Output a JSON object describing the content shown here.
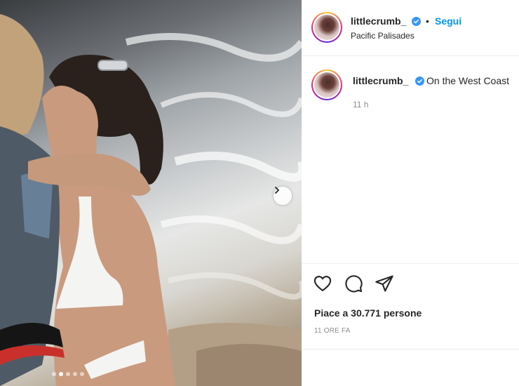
{
  "post": {
    "username": "littlecrumb_",
    "follow_label": "Segui",
    "separator": "•",
    "location": "Pacific Palisades",
    "caption": {
      "username": "littlecrumb_",
      "text": "On the West Coast",
      "time": "11 h"
    },
    "likes_text": "Piace a 30.771 persone",
    "time_ago": "11 ORE FA",
    "carousel": {
      "total_slides": 5,
      "active_slide": 2
    }
  },
  "icons": {
    "verified": "verified-badge-icon",
    "like": "heart-icon",
    "comment": "comment-bubble-icon",
    "share": "paper-plane-icon",
    "next": "chevron-right-icon"
  },
  "colors": {
    "accent": "#0095f6",
    "verified": "#3897f0",
    "text": "#262626",
    "muted": "#8e8e8e",
    "divider": "#efefef"
  }
}
